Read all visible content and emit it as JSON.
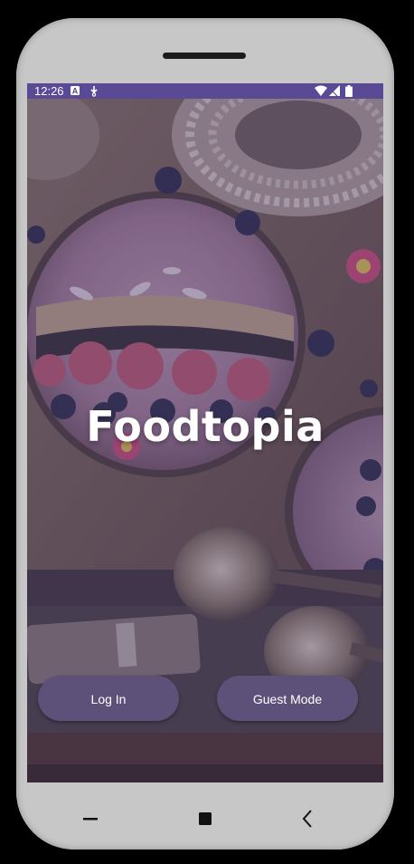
{
  "status_bar": {
    "time": "12:26",
    "icons": [
      "notification-a-icon",
      "download-icon",
      "wifi-icon",
      "signal-icon",
      "battery-icon"
    ]
  },
  "app": {
    "title": "Foodtopia"
  },
  "actions": {
    "login_label": "Log In",
    "guest_label": "Guest Mode"
  },
  "nav_bar": {
    "items": [
      "recents-icon",
      "home-icon",
      "back-icon"
    ]
  },
  "colors": {
    "status_bar": "#5a4a95",
    "button": "#5d5079",
    "overlay": "#483a68"
  }
}
